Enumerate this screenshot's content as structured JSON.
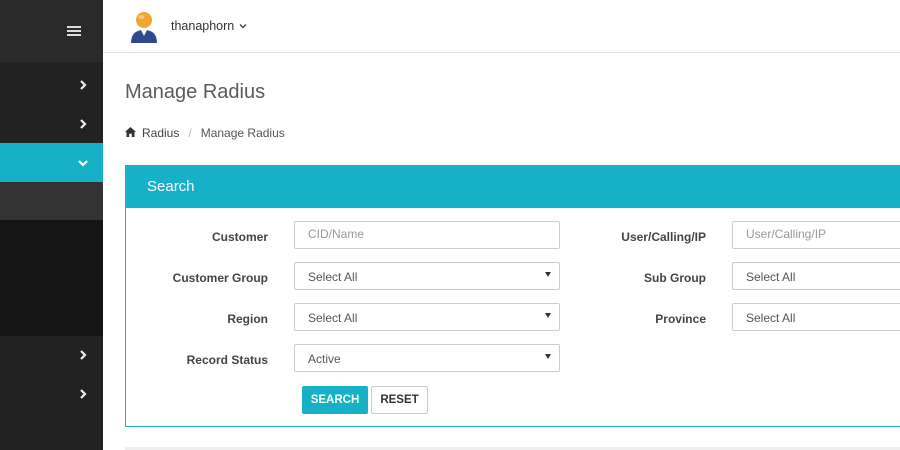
{
  "header": {
    "username": "thanaphorn"
  },
  "page": {
    "title": "Manage Radius"
  },
  "breadcrumb": {
    "items": [
      "Radius",
      "Manage Radius"
    ]
  },
  "search_panel": {
    "title": "Search",
    "fields": {
      "customer": {
        "label": "Customer",
        "placeholder": "CID/Name"
      },
      "user_calling_ip": {
        "label": "User/Calling/IP",
        "placeholder": "User/Calling/IP"
      },
      "customer_group": {
        "label": "Customer Group",
        "value": "Select All"
      },
      "sub_group": {
        "label": "Sub Group",
        "value": "Select All"
      },
      "region": {
        "label": "Region",
        "value": "Select All"
      },
      "province": {
        "label": "Province",
        "value": "Select All"
      },
      "record_status": {
        "label": "Record Status",
        "value": "Active"
      }
    },
    "buttons": {
      "search": "SEARCH",
      "reset": "RESET"
    }
  },
  "colors": {
    "accent": "#16b1c6",
    "sidebar": "#222222"
  },
  "icons": [
    "menu-icon",
    "chevron-right-icon",
    "chevron-down-icon",
    "home-icon",
    "user-avatar-icon"
  ]
}
